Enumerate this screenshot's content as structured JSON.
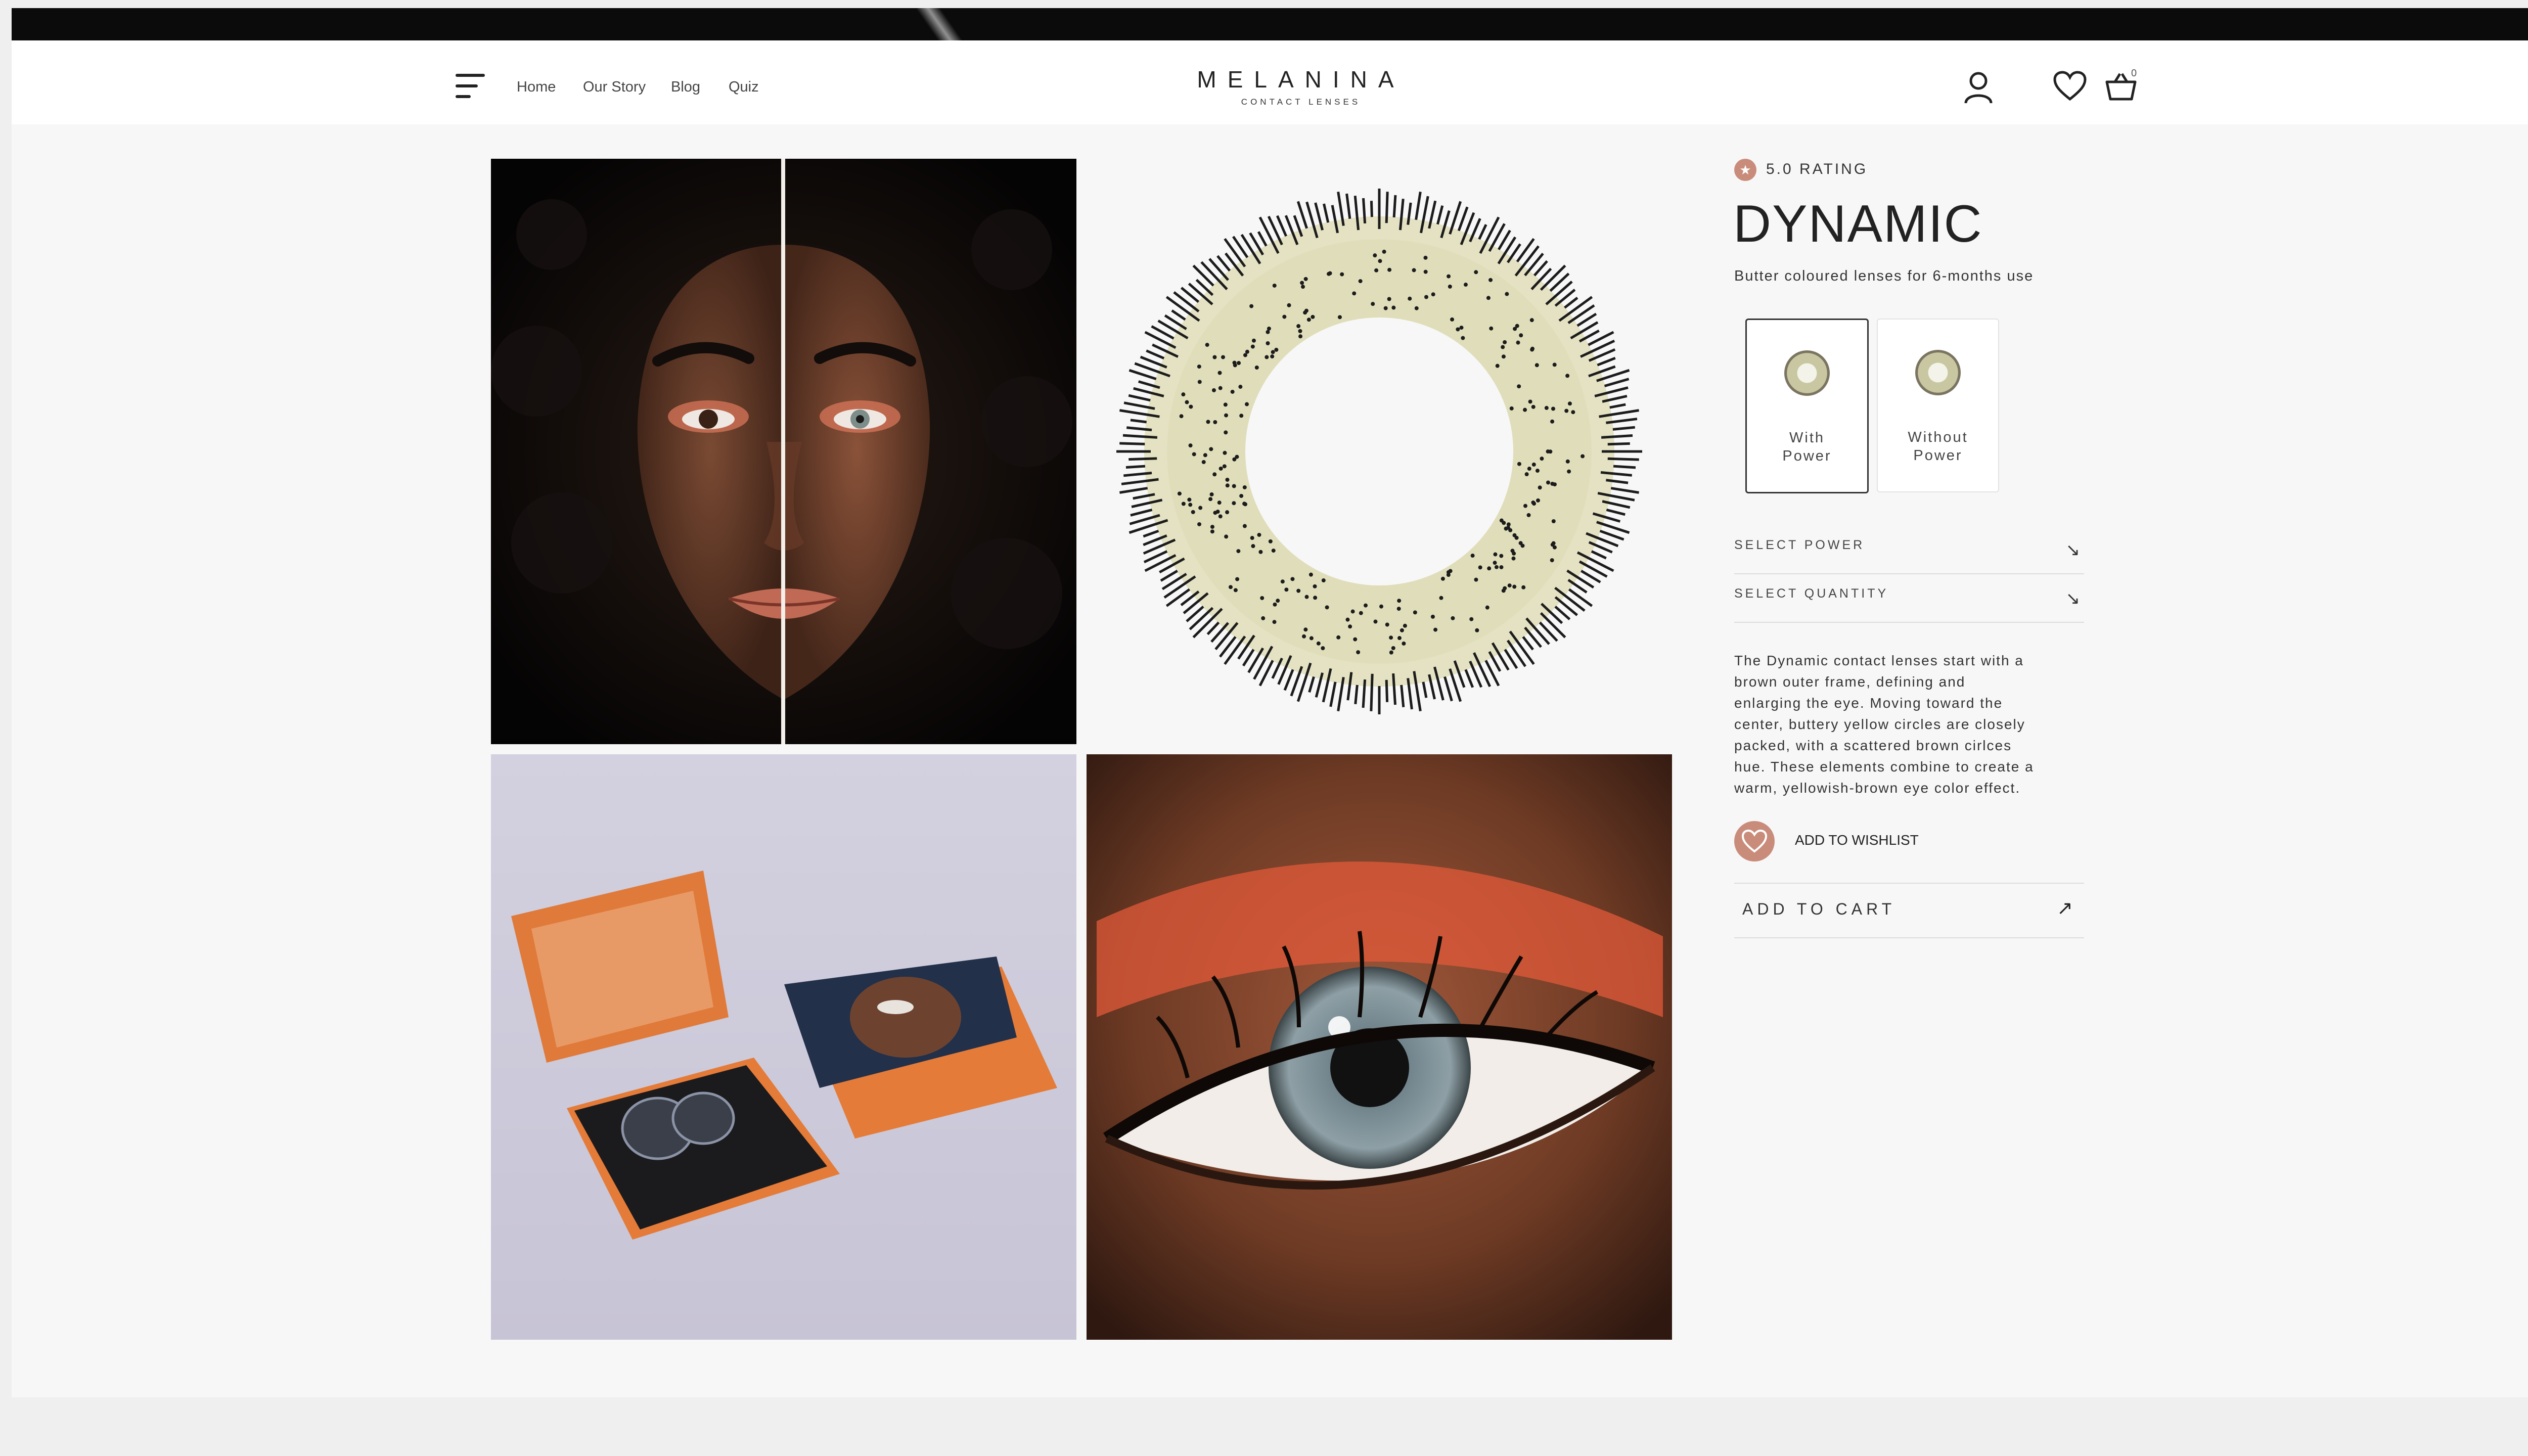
{
  "header": {
    "nav_links": [
      "Home",
      "Our Story",
      "Blog",
      "Quiz"
    ],
    "logo_text": "MELANINA",
    "logo_subtext": "CONTACT LENSES",
    "cart_count": "0",
    "icons": [
      "menu-icon",
      "user-icon",
      "heart-icon",
      "basket-icon"
    ]
  },
  "gallery": {
    "images": [
      "model-split-face",
      "lens-pattern",
      "product-box",
      "eye-closeup"
    ]
  },
  "product": {
    "rating_text": "5.0 RATING",
    "title": "DYNAMIC",
    "subtitle": "Butter coloured lenses for 6-months use",
    "options": [
      {
        "line1": "With",
        "line2": "Power",
        "selected": true
      },
      {
        "line1": "Without",
        "line2": "Power",
        "selected": false
      }
    ],
    "select_power_label": "SELECT POWER",
    "select_quantity_label": "SELECT QUANTITY",
    "description_lines": [
      "The Dynamic contact lenses start with a",
      "brown outer frame, defining and",
      "enlarging the eye. Moving toward the",
      "center, buttery yellow circles are closely",
      "packed, with a scattered brown cirlces",
      "hue. These elements combine to create a",
      "warm, yellowish-brown eye color effect."
    ],
    "wishlist_label": "ADD TO WISHLIST",
    "add_to_cart_label": "ADD TO CART"
  },
  "colors": {
    "accent": "#c98c7b",
    "topbar": "#0b0b0b",
    "page_bg": "#f7f7f7"
  }
}
